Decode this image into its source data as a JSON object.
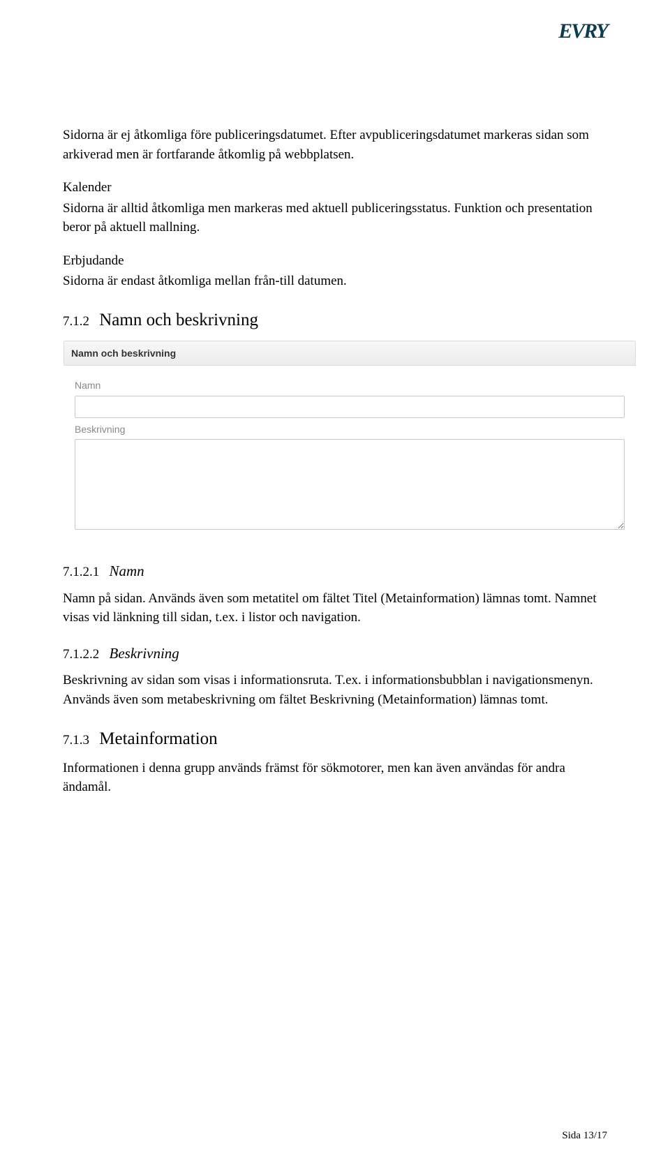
{
  "logo": "EVRY",
  "body": {
    "p1": "Sidorna är ej åtkomliga före publiceringsdatumet. Efter avpubliceringsdatumet markeras sidan som arkiverad men är fortfarande åtkomlig på webbplatsen.",
    "kalender_h": "Kalender",
    "kalender_txt": "Sidorna är alltid åtkomliga men markeras med aktuell publiceringsstatus. Funktion och presentation beror på aktuell mallning.",
    "erbjudande_h": "Erbjudande",
    "erbjudande_txt": "Sidorna är endast åtkomliga mellan från-till datumen."
  },
  "sec_712": {
    "num": "7.1.2",
    "title": "Namn och beskrivning"
  },
  "form": {
    "panel_title": "Namn och beskrivning",
    "label_namn": "Namn",
    "val_namn": "",
    "label_besk": "Beskrivning",
    "val_besk": ""
  },
  "sec_7121": {
    "num": "7.1.2.1",
    "title": "Namn",
    "p": "Namn på sidan. Används även som metatitel om fältet Titel (Metainformation) lämnas tomt. Namnet visas vid länkning till sidan, t.ex. i listor och navigation."
  },
  "sec_7122": {
    "num": "7.1.2.2",
    "title": "Beskrivning",
    "p": "Beskrivning av sidan som visas i informationsruta. T.ex. i informationsbubblan i navigationsmenyn. Används även som metabeskrivning om fältet Beskrivning (Metainformation) lämnas tomt."
  },
  "sec_713": {
    "num": "7.1.3",
    "title": "Metainformation",
    "p": "Informationen i denna grupp används främst för sökmotorer, men kan även användas för andra ändamål."
  },
  "footer": "Sida 13/17"
}
